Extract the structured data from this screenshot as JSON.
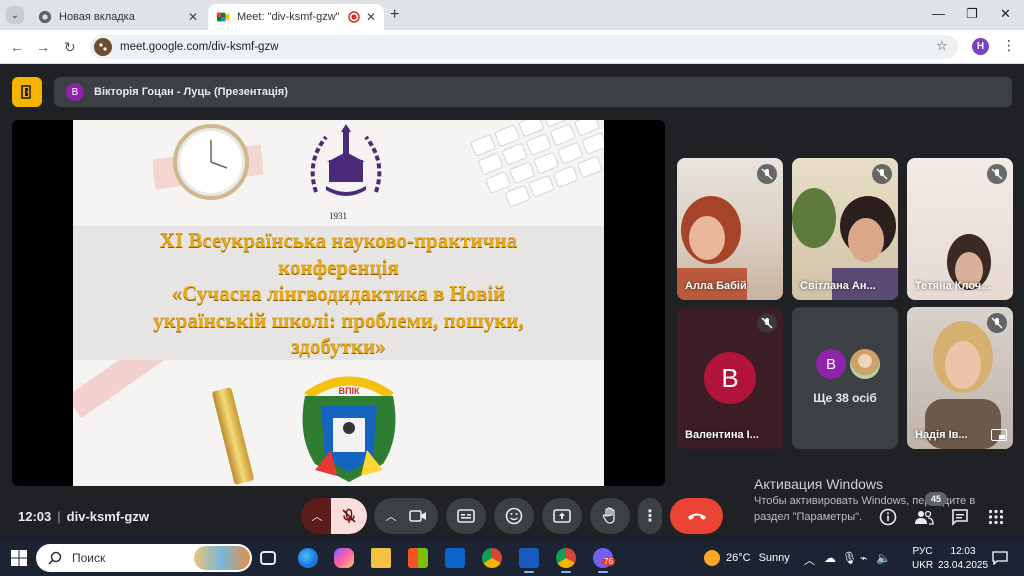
{
  "browser": {
    "tabs": [
      {
        "title": "Новая вкладка",
        "active": false
      },
      {
        "title": "Meet: \"div-ksmf-gzw\"",
        "active": true
      }
    ],
    "url": "meet.google.com/div-ksmf-gzw",
    "profile_initial": "H"
  },
  "meet": {
    "presenter": {
      "initial": "В",
      "banner": "Вікторія Гоцан - Луць (Презентація)"
    },
    "slide": {
      "year": "1931",
      "headline_lines": [
        "XI Всеукраїнська науково-практична",
        "конференція",
        "«Сучасна лінгводидактика в Новій",
        "українській школі: проблеми, пошуки,",
        "здобутки»"
      ],
      "crest_text": "ВПІК"
    },
    "participants": [
      {
        "name": "Алла Бабій",
        "muted": true
      },
      {
        "name": "Світлана Ан...",
        "muted": true
      },
      {
        "name": "Тетяна Клоч...",
        "muted": true
      },
      {
        "name": "Валентина І...",
        "muted": true,
        "avatar_initial": "В",
        "avatar_color": "#b3133b"
      },
      {
        "others_label": "Ще 38 осіб",
        "avatar_initial": "В"
      },
      {
        "name": "Надія Ів...",
        "muted": true
      }
    ],
    "meeting_time": "12:03",
    "meeting_code": "div-ksmf-gzw",
    "participant_count": "45"
  },
  "windows_activation": {
    "title": "Активация Windows",
    "line1": "Чтобы активировать Windows, перейдите в",
    "line2": "раздел \"Параметры\"."
  },
  "taskbar": {
    "search_placeholder": "Поиск",
    "weather_temp": "26°C",
    "weather_desc": "Sunny",
    "lang_top": "РУС",
    "lang_bottom": "UKR",
    "clock_time": "12:03",
    "clock_date": "23.04.2025",
    "viber_badge": "76"
  },
  "colors": {
    "meet_bg": "#202124",
    "tile_bg": "#3c4043",
    "leave_red": "#ea4335",
    "accent_yellow": "#f4b400",
    "slide_gold": "#e6a91a"
  }
}
